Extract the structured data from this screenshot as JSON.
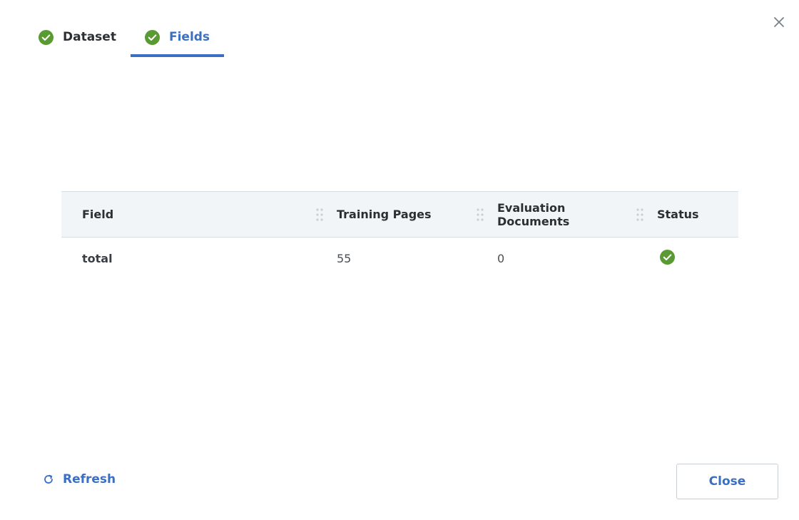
{
  "tabs": [
    {
      "label": "Dataset",
      "state": "inactive",
      "icon": "check-circle-icon"
    },
    {
      "label": "Fields",
      "state": "active",
      "icon": "check-circle-icon"
    }
  ],
  "colors": {
    "accent": "#3a6fc4",
    "success": "#5a9a32",
    "header_bg": "#f1f5f8"
  },
  "table": {
    "columns": [
      "Field",
      "Training Pages",
      "Evaluation Documents",
      "Status"
    ],
    "rows": [
      {
        "field": "total",
        "training_pages": "55",
        "evaluation_documents": "0",
        "status_icon": "check-circle-icon"
      }
    ]
  },
  "footer": {
    "refresh_label": "Refresh",
    "close_label": "Close"
  }
}
